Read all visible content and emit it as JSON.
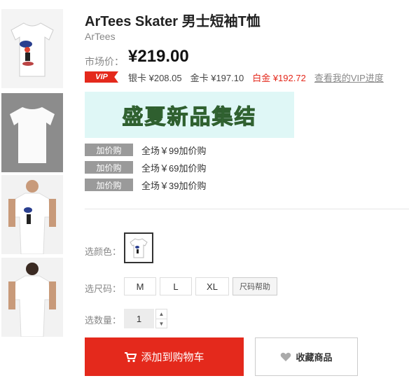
{
  "product": {
    "title": "ArTees Skater 男士短袖T恤",
    "brand": "ArTees",
    "market_price_label": "市场价：",
    "market_price": "¥219.00"
  },
  "vip": {
    "badge": "VIP",
    "prices": [
      {
        "label": "银卡 ¥208.05"
      },
      {
        "label": "金卡 ¥197.10"
      },
      {
        "label": "白金 ¥192.72"
      }
    ],
    "link": "查看我的VIP进度"
  },
  "banner": {
    "text": "盛夏新品集结"
  },
  "promos": [
    {
      "tag": "加价购",
      "text": "全场￥99加价购"
    },
    {
      "tag": "加价购",
      "text": "全场￥69加价购"
    },
    {
      "tag": "加价购",
      "text": "全场￥39加价购"
    }
  ],
  "options": {
    "color_label": "选颜色：",
    "size_label": "选尺码：",
    "sizes": [
      "M",
      "L",
      "XL"
    ],
    "size_help": "尺码帮助",
    "qty_label": "选数量：",
    "qty_value": "1",
    "stepper_up": "▲",
    "stepper_down": "▼"
  },
  "actions": {
    "add_cart": "添加到购物车",
    "favorite": "收藏商品"
  },
  "colors": {
    "accent": "#e4291c",
    "tag_gray": "#9a9a9a"
  }
}
